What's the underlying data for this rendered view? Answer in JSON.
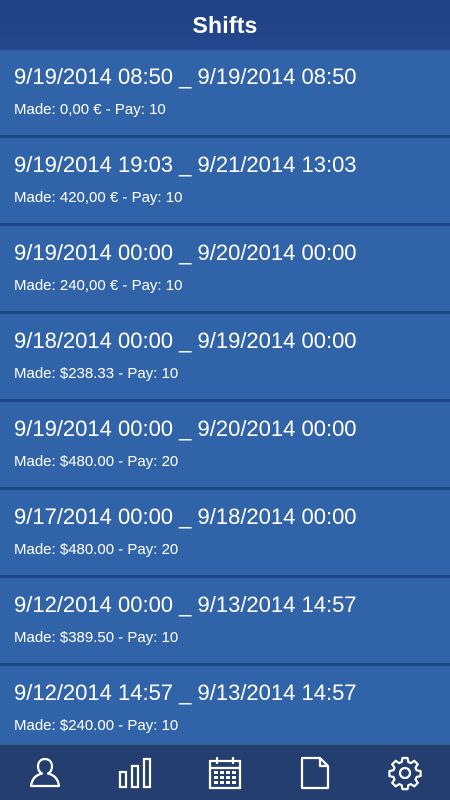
{
  "header": {
    "title": "Shifts"
  },
  "shifts": [
    {
      "range": "9/19/2014 08:50 _ 9/19/2014 08:50",
      "made": "Made: 0,00 € - Pay: 10"
    },
    {
      "range": "9/19/2014 19:03 _ 9/21/2014 13:03",
      "made": "Made: 420,00 € - Pay: 10"
    },
    {
      "range": "9/19/2014 00:00 _ 9/20/2014 00:00",
      "made": "Made: 240,00 € - Pay: 10"
    },
    {
      "range": "9/18/2014 00:00 _ 9/19/2014 00:00",
      "made": "Made: $238.33 - Pay: 10"
    },
    {
      "range": "9/19/2014 00:00 _ 9/20/2014 00:00",
      "made": "Made: $480.00 - Pay: 20"
    },
    {
      "range": "9/17/2014 00:00 _ 9/18/2014 00:00",
      "made": "Made: $480.00 - Pay: 20"
    },
    {
      "range": "9/12/2014 00:00 _ 9/13/2014 14:57",
      "made": "Made: $389.50 - Pay: 10"
    },
    {
      "range": "9/12/2014 14:57 _ 9/13/2014 14:57",
      "made": "Made: $240.00 - Pay: 10"
    }
  ],
  "tabs": [
    {
      "icon": "user-icon"
    },
    {
      "icon": "bar-chart-icon"
    },
    {
      "icon": "calendar-icon"
    },
    {
      "icon": "document-icon"
    },
    {
      "icon": "gear-icon"
    }
  ],
  "colors": {
    "header_bg": "#24478d",
    "row_bg": "#3163a8",
    "row_separator": "#1f4582",
    "tabbar_bg": "#243e6f",
    "text": "#ffffff"
  }
}
